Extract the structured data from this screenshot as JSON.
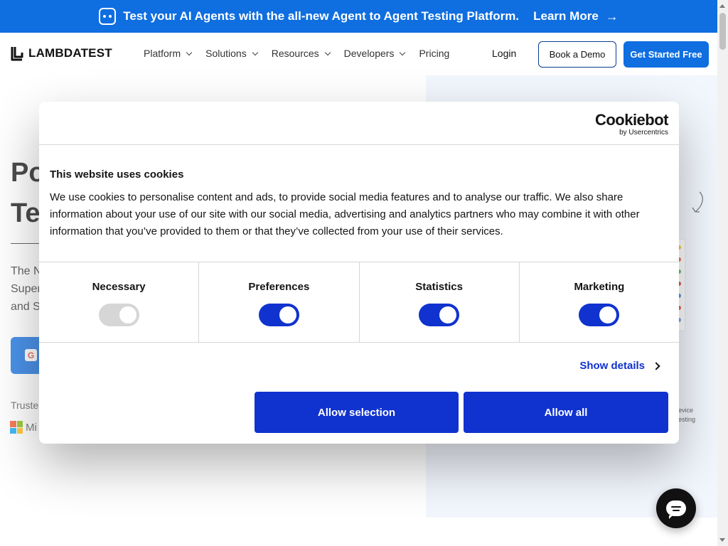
{
  "announcement": {
    "text": "Test your AI Agents with the all-new Agent to Agent Testing Platform.",
    "link": "Learn More",
    "arrow": "→"
  },
  "header": {
    "brand": "LAMBDATEST",
    "nav": [
      {
        "label": "Platform"
      },
      {
        "label": "Solutions"
      },
      {
        "label": "Resources"
      },
      {
        "label": "Developers"
      },
      {
        "label": "Pricing"
      }
    ],
    "login": "Login",
    "book_demo": "Book a Demo",
    "get_started": "Get Started Free"
  },
  "hero": {
    "title_line1": "Po",
    "title_line2": "Te",
    "subtitle_line1": "The N",
    "subtitle_line2": "Super",
    "subtitle_line3": "and S",
    "trusted": "Truste",
    "ms_partial": "Mi",
    "side_hint_1": "evice",
    "side_hint_2": "esting"
  },
  "cookie_dialog": {
    "brand": "Cookiebot",
    "brand_sub": "by Usercentrics",
    "title": "This website uses cookies",
    "description": "We use cookies to personalise content and ads, to provide social media features and to analyse our traffic. We also share information about your use of our site with our social media, advertising and analytics partners who may combine it with other information that you’ve provided to them or that they’ve collected from your use of their services.",
    "categories": [
      {
        "label": "Necessary",
        "enabled": true,
        "locked": true
      },
      {
        "label": "Preferences",
        "enabled": true,
        "locked": false
      },
      {
        "label": "Statistics",
        "enabled": true,
        "locked": false
      },
      {
        "label": "Marketing",
        "enabled": true,
        "locked": false
      }
    ],
    "show_details": "Show details",
    "allow_selection": "Allow selection",
    "allow_all": "Allow all"
  },
  "colors": {
    "brand_blue": "#0f6ee0",
    "cookiebot_blue": "#1032cf",
    "toggle_disabled": "#d6d6d6",
    "hero_panel": "#eef3fd"
  },
  "icons": {
    "announcement": "robot-icon",
    "nav_chevron": "chevron-down-icon",
    "details": "chevron-right-icon",
    "chat": "chat-bubble-icon"
  }
}
